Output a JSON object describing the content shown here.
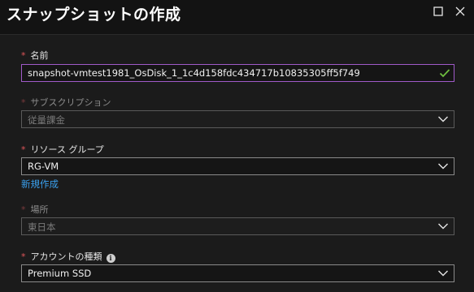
{
  "header": {
    "title": "スナップショットの作成"
  },
  "required_mark": "*",
  "form": {
    "name": {
      "label": "名前",
      "value": "snapshot-vmtest1981_OsDisk_1_1c4d158fdc434717b10835305ff5f749"
    },
    "subscription": {
      "label": "サブスクリプション",
      "value": "従量課金"
    },
    "resource_group": {
      "label": "リソース グループ",
      "value": "RG-VM",
      "create_new_link": "新規作成"
    },
    "location": {
      "label": "場所",
      "value": "東日本"
    },
    "account_type": {
      "label": "アカウントの種類",
      "info_icon": "i",
      "value": "Premium SSD"
    }
  },
  "colors": {
    "background": "#1b1b1b",
    "header_background": "#131313",
    "required": "#e0565a",
    "link": "#3aa0ee",
    "valid_check": "#6fbf3f",
    "active_border": "#a05ac8"
  }
}
